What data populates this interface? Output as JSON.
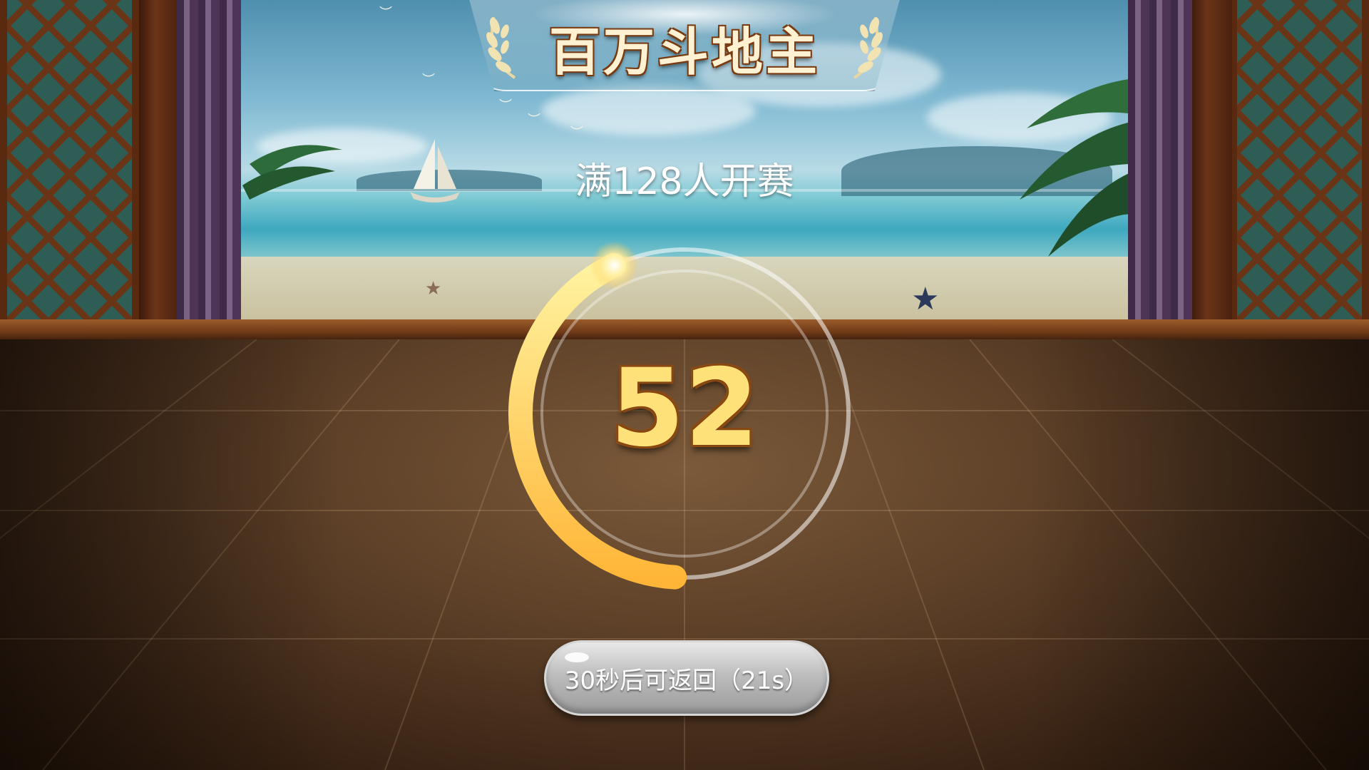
{
  "game": {
    "title": "百万斗地主",
    "subtitle": "满128人开赛",
    "countdown": "52",
    "ring_progress_fraction": 0.42,
    "return_button_label": "30秒后可返回（21s）"
  },
  "colors": {
    "title_text": "#fff1d2",
    "count_text": "#ffe17a",
    "ring_start": "#fff3a0",
    "ring_end": "#ffb638",
    "button_bg": "#bdbdbd"
  },
  "icons": {
    "laurel_left": "laurel-left-icon",
    "laurel_right": "laurel-right-icon",
    "sparkle": "sparkle-icon"
  }
}
